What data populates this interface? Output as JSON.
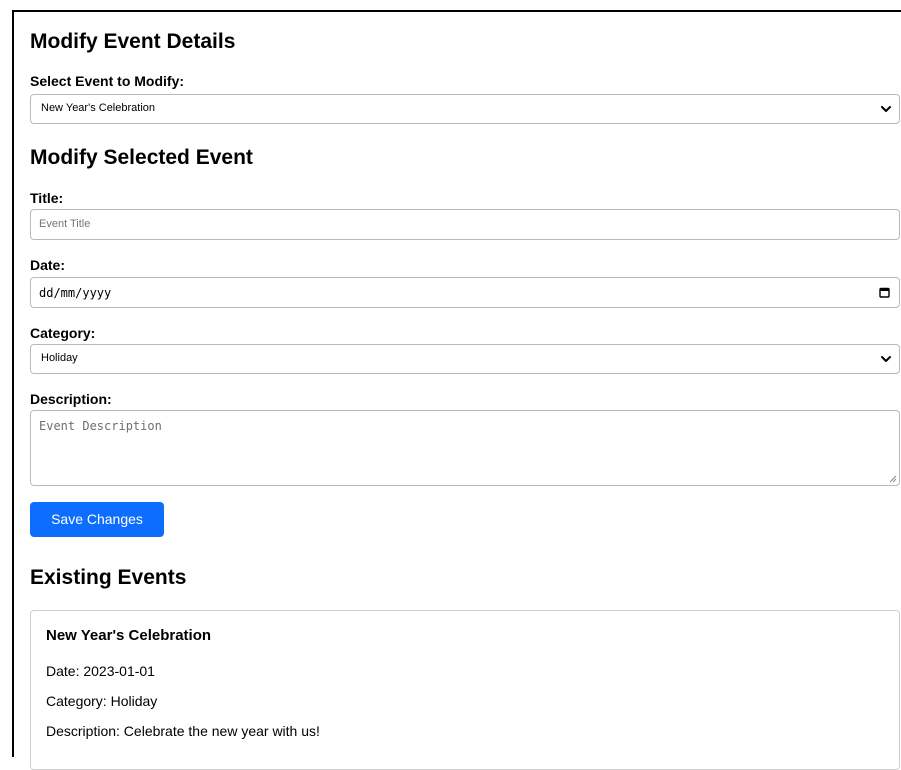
{
  "header": {
    "title": "Modify Event Details"
  },
  "event_select": {
    "label": "Select Event to Modify:",
    "selected": "New Year's Celebration"
  },
  "modify_section": {
    "title": "Modify Selected Event",
    "title_label": "Title:",
    "title_placeholder": "Event Title",
    "date_label": "Date:",
    "date_placeholder": "dd/mm/yyyy",
    "category_label": "Category:",
    "category_selected": "Holiday",
    "description_label": "Description:",
    "description_placeholder": "Event Description",
    "save_label": "Save Changes"
  },
  "existing": {
    "title": "Existing Events",
    "events": [
      {
        "title": "New Year's Celebration",
        "date": "Date: 2023-01-01",
        "category": "Category: Holiday",
        "description": "Description: Celebrate the new year with us!"
      }
    ]
  },
  "colors": {
    "accent": "#0d6efd",
    "border": "#b9b9b9"
  },
  "icons": {
    "select_arrow": "chevron-down-icon",
    "date_picker": "calendar-icon",
    "resize": "resize-grip-icon"
  }
}
